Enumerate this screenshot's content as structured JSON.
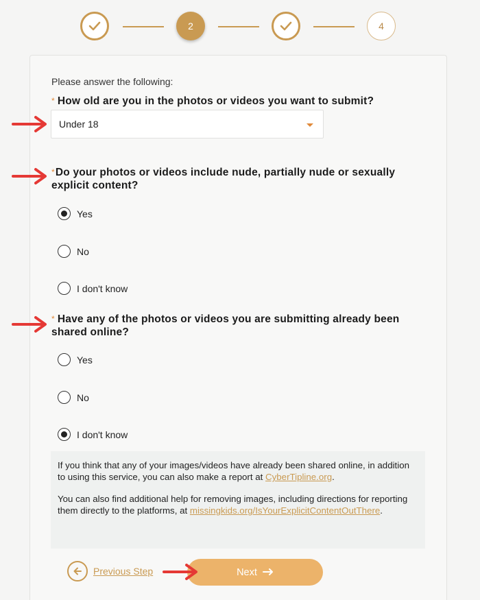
{
  "stepper": {
    "steps": [
      {
        "label": "",
        "state": "done"
      },
      {
        "label": "2",
        "state": "active"
      },
      {
        "label": "",
        "state": "done"
      },
      {
        "label": "4",
        "state": "todo"
      }
    ]
  },
  "form": {
    "intro": "Please answer the following:",
    "required_mark": "*",
    "q1": {
      "label": "How old are you in the photos or videos you want to submit?",
      "selected": "Under 18"
    },
    "q2": {
      "label_line1": "Do your photos or videos include nude, partially nude or sexually",
      "label_line2": "explicit content?",
      "options": [
        "Yes",
        "No",
        "I don't know"
      ],
      "selected": "Yes"
    },
    "q3": {
      "label_line1": "Have any of the photos or videos you are submitting already been",
      "label_line2": "shared online?",
      "options": [
        "Yes",
        "No",
        "I don't know"
      ],
      "selected": "I don't know"
    },
    "info": {
      "p1_text": "If you think that any of your images/videos have already been shared online, in addition to using this service, you can also make a report at ",
      "p1_link": "CyberTipline.org",
      "p1_end": ".",
      "p2_text": "You can also find additional help for removing images, including directions for reporting them directly to the platforms, at ",
      "p2_link": "missingkids.org/IsYourExplicitContentOutThere",
      "p2_end": "."
    },
    "prev_label": "Previous Step",
    "next_label": "Next"
  },
  "colors": {
    "accent": "#c99a52",
    "next_button": "#ecb36a",
    "annotation_arrow": "#e53935"
  }
}
